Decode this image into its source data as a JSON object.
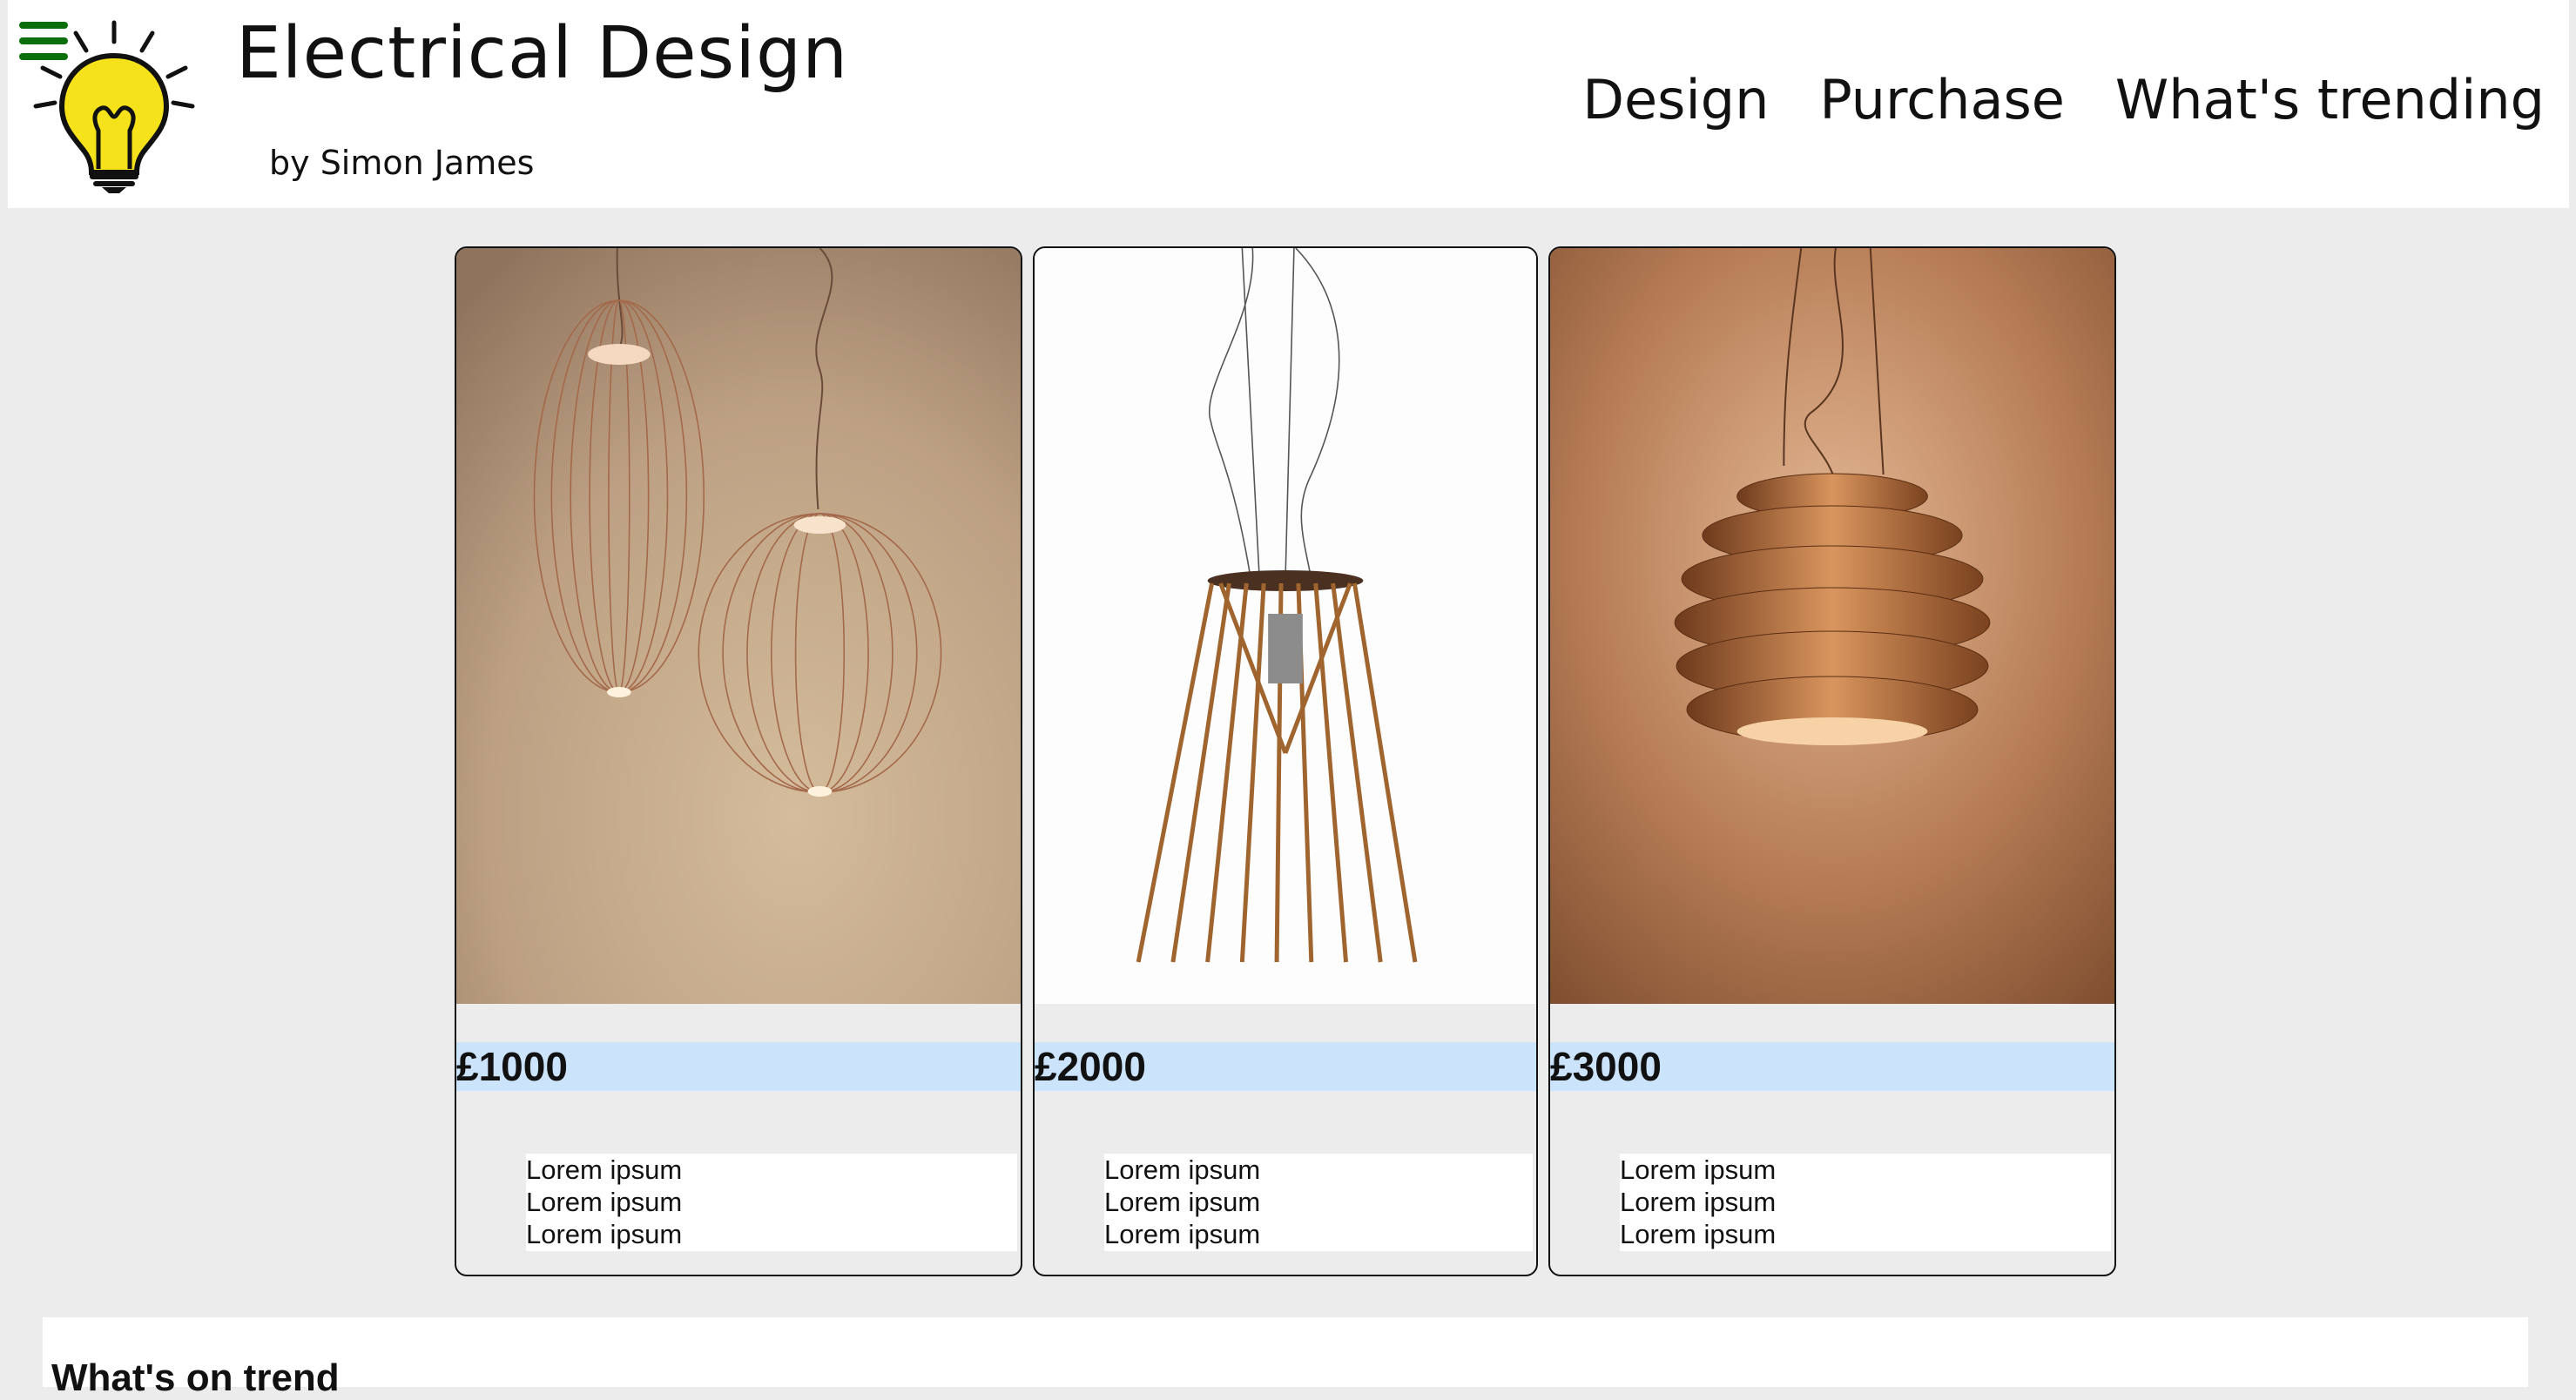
{
  "header": {
    "title": "Electrical Design",
    "byline": "by Simon James",
    "nav": [
      "Design",
      "Purchase",
      "What's trending"
    ]
  },
  "products": [
    {
      "price": "£1000",
      "lines": [
        "Lorem ipsum",
        "Lorem ipsum",
        "Lorem ipsum"
      ]
    },
    {
      "price": "£2000",
      "lines": [
        "Lorem ipsum",
        "Lorem ipsum",
        "Lorem ipsum"
      ]
    },
    {
      "price": "£3000",
      "lines": [
        "Lorem ipsum",
        "Lorem ipsum",
        "Lorem ipsum"
      ]
    }
  ],
  "trend": {
    "heading": "What's on trend"
  },
  "icons": {
    "menu": "hamburger-menu-icon",
    "logo": "lightbulb-icon"
  },
  "colors": {
    "accent_green": "#0b6e0b",
    "price_band": "#cce4fb",
    "page_bg": "#ececec"
  }
}
